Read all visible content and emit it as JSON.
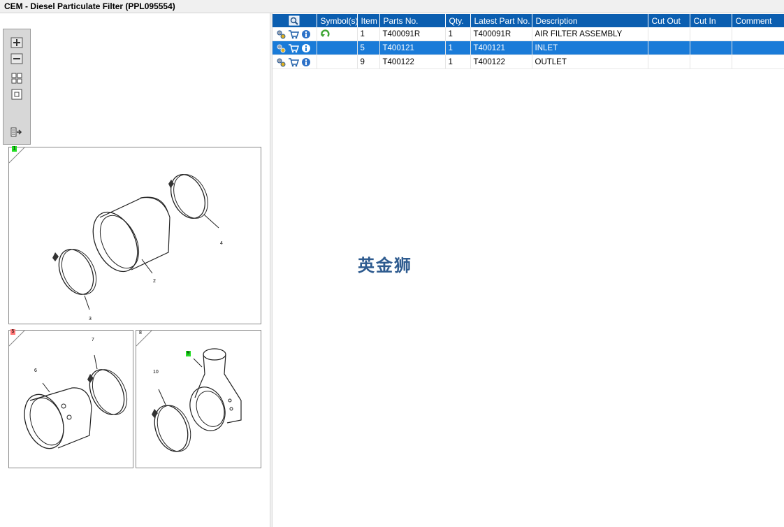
{
  "window": {
    "title": "CEM - Diesel Particulate Filter (PPL095554)"
  },
  "viewer": {
    "tools": [
      "zoom-in",
      "zoom-out",
      "fit-grid",
      "single-view",
      "export"
    ],
    "figures": [
      {
        "id": "fig-1",
        "badge": "1",
        "badge_color": "#22dd22",
        "callouts": [
          "2",
          "3",
          "4"
        ]
      },
      {
        "id": "fig-5",
        "badge": "5",
        "badge_color": "#ff7777",
        "callouts": [
          "6",
          "7"
        ]
      },
      {
        "id": "fig-8",
        "label": "8",
        "badge": "9",
        "badge_color": "#22dd22",
        "callouts": [
          "10"
        ]
      }
    ]
  },
  "parts_table": {
    "columns": [
      "",
      "Symbol(s)",
      "Item",
      "Parts No.",
      "Qty.",
      "Latest Part No.",
      "Description",
      "Cut Out",
      "Cut In",
      "Comment"
    ],
    "rows": [
      {
        "item": "1",
        "part_no": "T400091R",
        "qty": "1",
        "latest_part_no": "T400091R",
        "description": "AIR FILTER ASSEMBLY",
        "cut_out": "",
        "cut_in": "",
        "comment": "",
        "has_symbol": true,
        "selected": false
      },
      {
        "item": "5",
        "part_no": "T400121",
        "qty": "1",
        "latest_part_no": "T400121",
        "description": "INLET",
        "cut_out": "",
        "cut_in": "",
        "comment": "",
        "has_symbol": false,
        "selected": true
      },
      {
        "item": "9",
        "part_no": "T400122",
        "qty": "1",
        "latest_part_no": "T400122",
        "description": "OUTLET",
        "cut_out": "",
        "cut_in": "",
        "comment": "",
        "has_symbol": false,
        "selected": false
      }
    ]
  },
  "watermark": "英金狮",
  "colors": {
    "header_bg": "#0b5eb0",
    "selected_row": "#1a7bd8",
    "accent_green": "#3fa535"
  }
}
